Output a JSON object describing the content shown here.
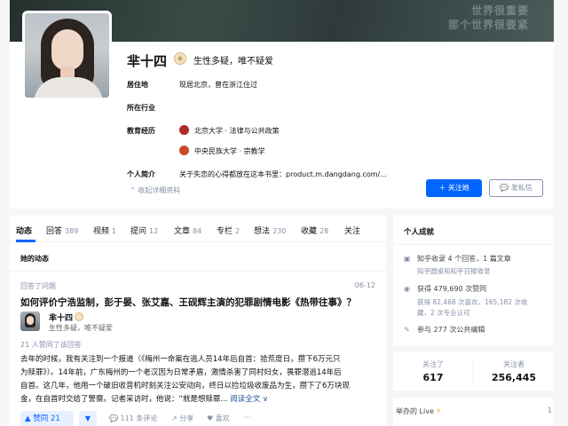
{
  "cover": {
    "text_line1": "世界很重要",
    "text_line2": "那个世界很要紧"
  },
  "profile": {
    "name": "芈十四",
    "headline": "生性多疑，唯不疑爱",
    "residence_label": "居住地",
    "residence_value": "现居北京，曾在浙江住过",
    "industry_label": "所在行业",
    "education_label": "教育经历",
    "education": [
      {
        "text": "北京大学 · 法律与公共政策"
      },
      {
        "text": "中央民族大学 · 宗教学"
      }
    ],
    "bio_label": "个人简介",
    "bio_value": "关于失恋的心得都放在这本书里：product.m.dangdang.com/...",
    "collapse_link": "收起详细资料",
    "follow_button": "关注她",
    "message_button": "发私信",
    "badge_icon": "badge-icon"
  },
  "tabs": [
    {
      "label": "动态",
      "count": ""
    },
    {
      "label": "回答",
      "count": "389"
    },
    {
      "label": "视频",
      "count": "1"
    },
    {
      "label": "提问",
      "count": "12"
    },
    {
      "label": "文章",
      "count": "84"
    },
    {
      "label": "专栏",
      "count": "2"
    },
    {
      "label": "想法",
      "count": "230"
    },
    {
      "label": "收藏",
      "count": "28"
    },
    {
      "label": "关注",
      "count": ""
    }
  ],
  "feed": {
    "section_title": "她的动态",
    "activity_label": "回答了问题",
    "activity_date": "06-12",
    "question_title": "如何评价宁浩监制，彭于晏、张艾嘉、王砚辉主演的犯罪剧情电影《热带往事》？",
    "author_name": "芈十四",
    "author_headline": "生性多疑，唯不疑爱",
    "upvote_info": "21 人赞同了该回答",
    "excerpt_line1": "去年的时候，我有关注到一个报道（《梅州一命案在逃人员14年后自首：拾荒度日，攒下6万元只",
    "excerpt_line2": "为赎罪》）。14年前，广东梅州的一个老汉因为日常矛盾，激情杀害了同村妇女，畏罪潜逃14年后",
    "excerpt_line3": "自首。这几年，他用一个破旧收音机时刻关注公安动向，终日以捡垃圾收废品为生，攒下了6万块现",
    "excerpt_line4": "金，在自首时交给了警察。记者采访时，他说：“就是想赎罪...",
    "read_more": "阅读全文 ∨",
    "upvote_button": "▲ 赞同 21",
    "downvote_button": "▼",
    "comments": "111 条评论",
    "share": "分享",
    "like": "喜欢",
    "more": "···"
  },
  "achievements": {
    "title": "个人成就",
    "line1": "知乎收录 4 个回答，1 篇文章",
    "line1_sub": "知乎圆桌和知乎日报收录",
    "line2": "获得 479,690 次赞同",
    "line2_sub1": "获得 82,468 次喜欢，165,182 次收",
    "line2_sub2": "藏，2 次专业认可",
    "line3": "参与 277 次公共编辑"
  },
  "follow_stats": {
    "following_label": "关注了",
    "following_value": "617",
    "followers_label": "关注者",
    "followers_value": "256,445"
  },
  "live": {
    "label": "举办的 Live",
    "count": "1"
  },
  "colors": {
    "accent": "#0066ff",
    "muted": "#8590a6",
    "link": "#175199"
  }
}
